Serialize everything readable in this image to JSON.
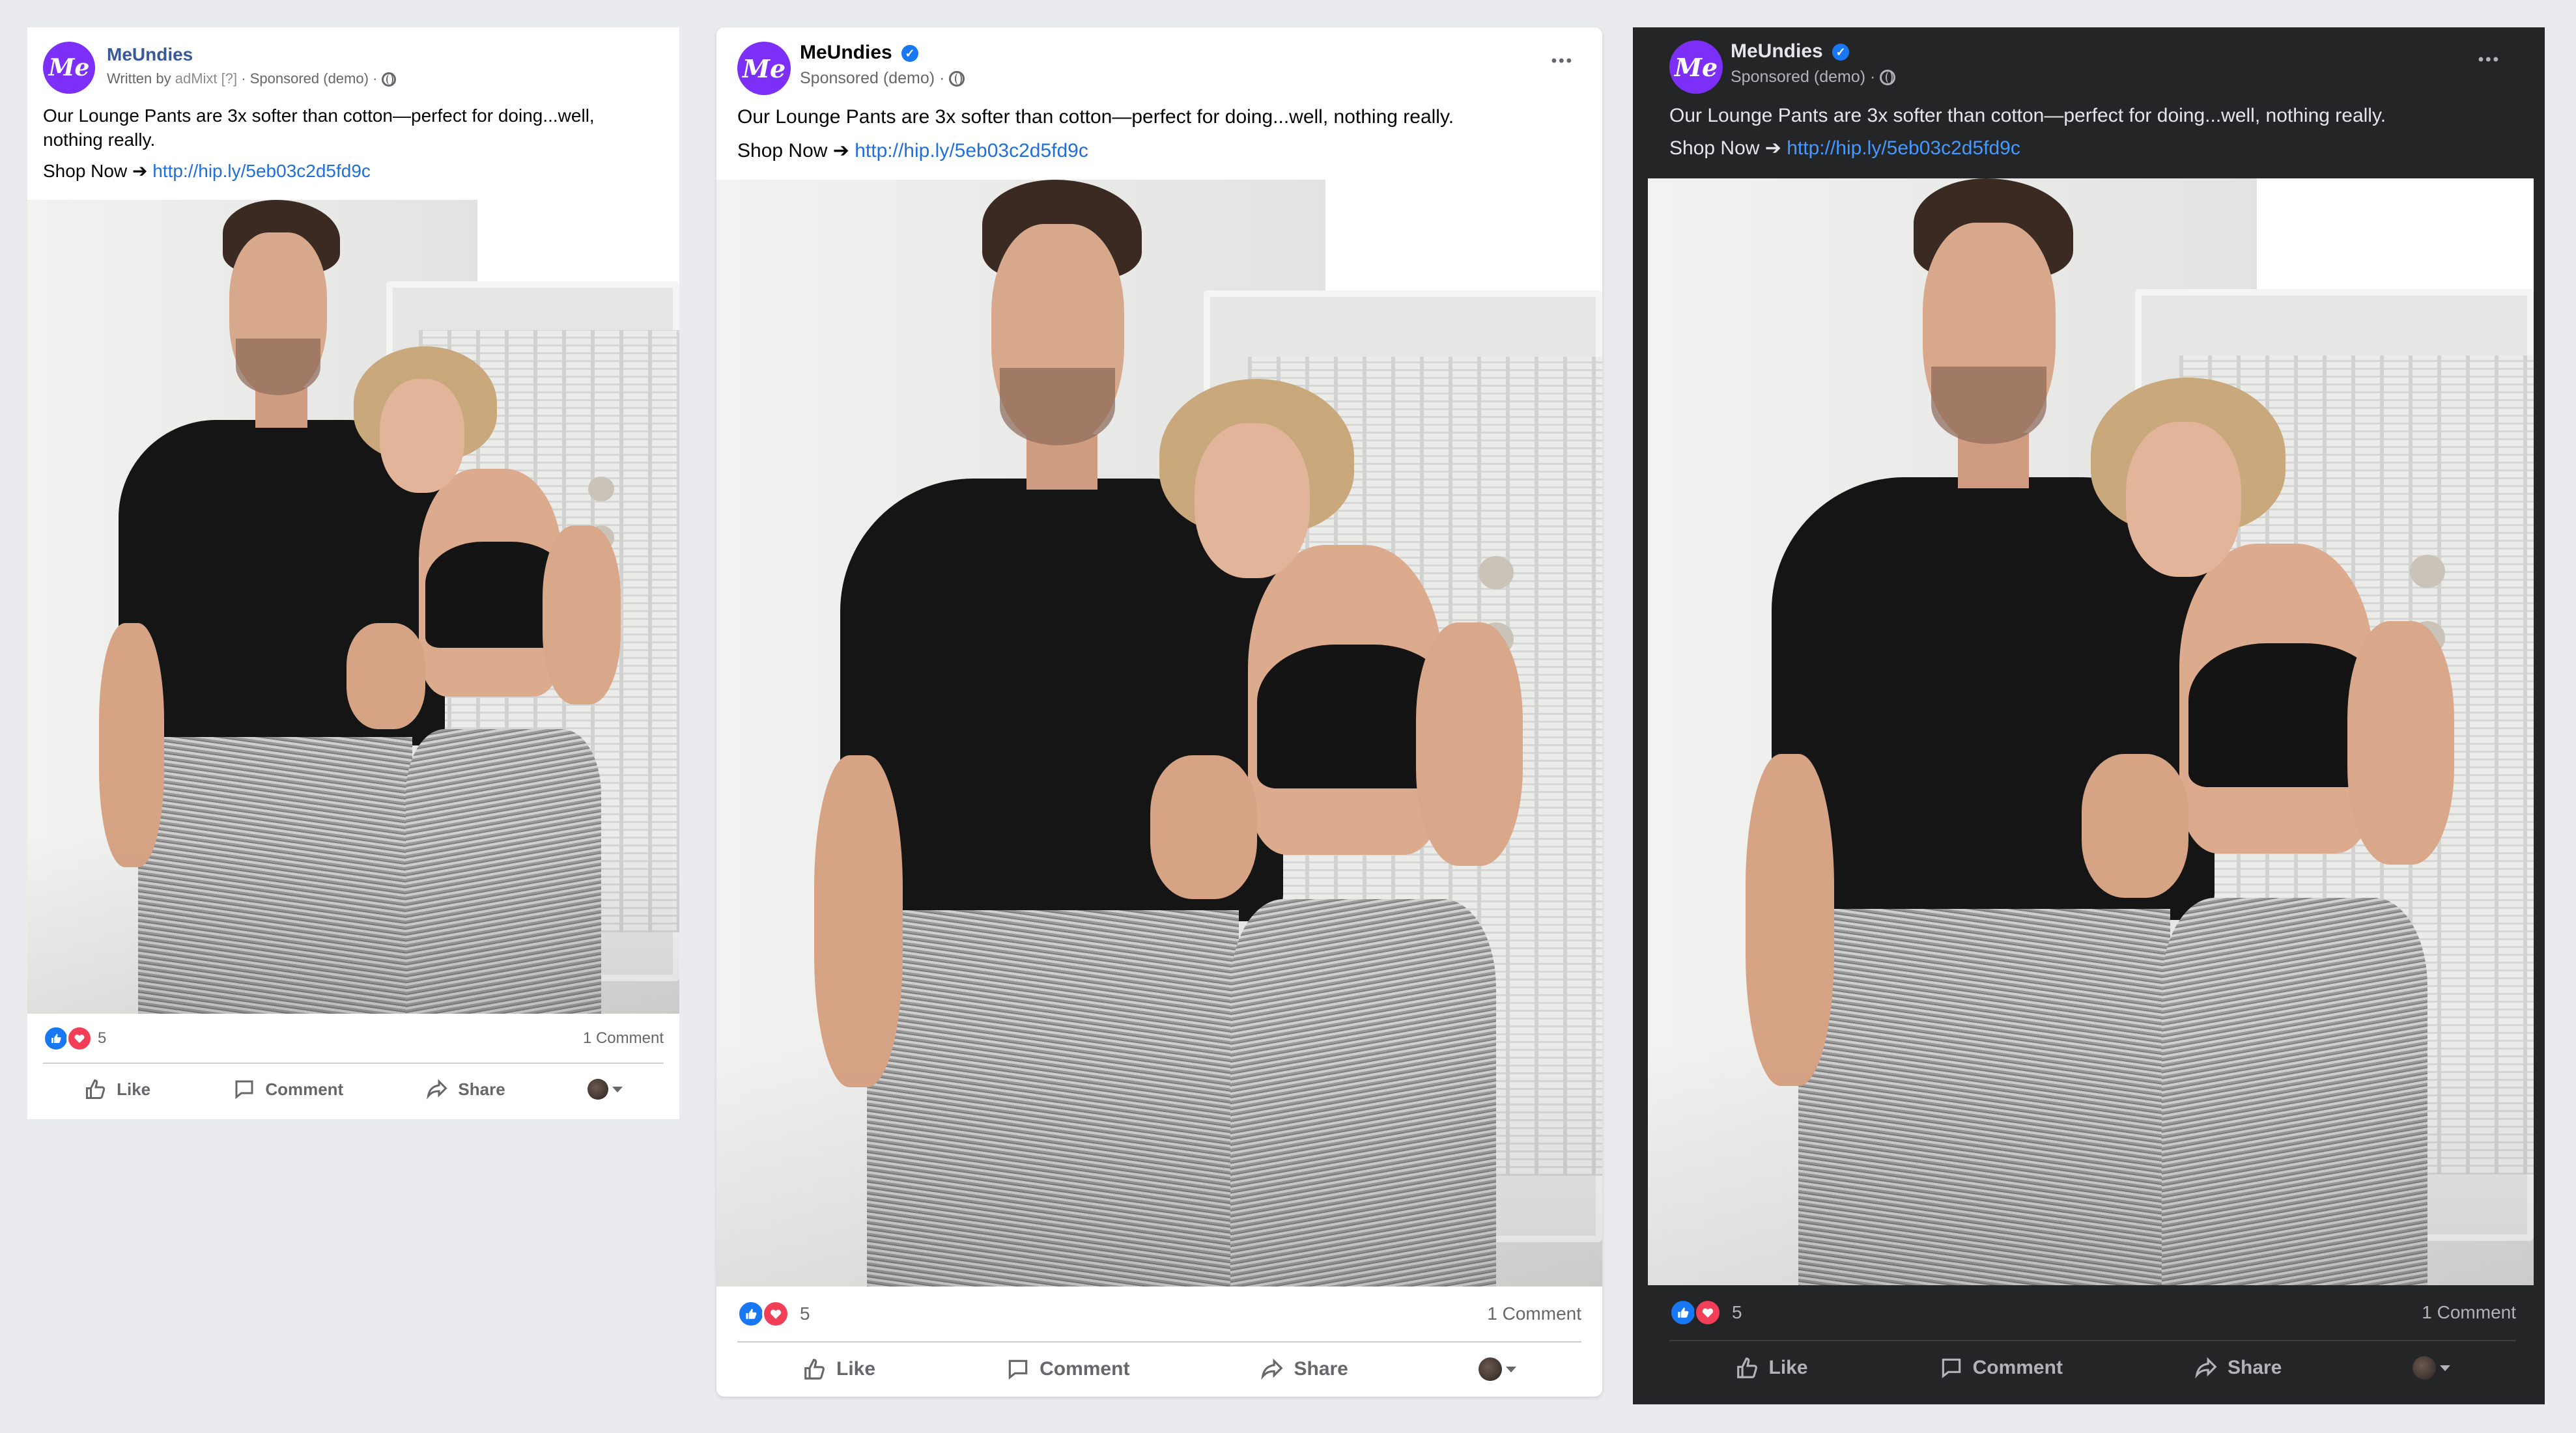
{
  "page_name": "MeUndies",
  "avatar_text": "Me",
  "written_by_prefix": "Written by",
  "written_by_name": "adMixt",
  "written_by_help": "[?]",
  "sponsored": "Sponsored (demo)",
  "separator": "·",
  "post_text": "Our Lounge Pants are 3x softer than cotton—perfect for doing...well, nothing really.",
  "cta_prefix": "Shop Now ➔",
  "cta_link": "http://hip.ly/5eb03c2d5fd9c",
  "reaction_count": "5",
  "comment_count": "1 Comment",
  "actions": {
    "like": "Like",
    "comment": "Comment",
    "share": "Share"
  },
  "more_menu": "•••",
  "verified_mark": "✓",
  "icons": [
    "globe-icon",
    "verified-badge-icon",
    "like-reaction-icon",
    "love-reaction-icon",
    "thumbs-up-icon",
    "comment-icon",
    "share-icon",
    "chevron-down-icon",
    "more-icon"
  ],
  "colors": {
    "brand_purple": "#7b2ff7",
    "facebook_blue": "#1877f2",
    "love_red": "#f33e58",
    "dark_card": "#242526",
    "page_bg": "#e9ebee"
  }
}
